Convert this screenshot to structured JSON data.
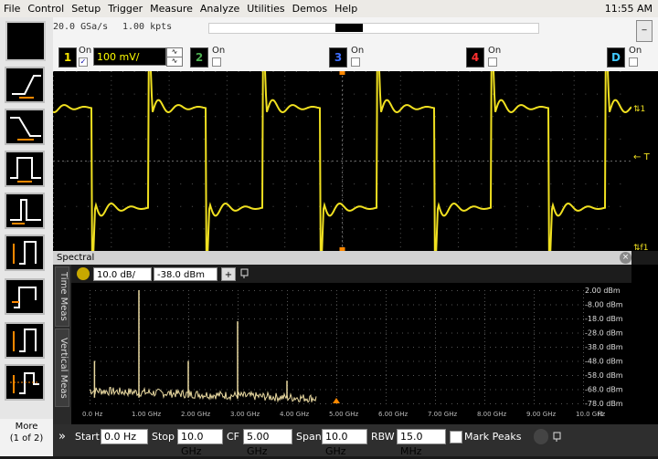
{
  "menu": {
    "items": [
      "File",
      "Control",
      "Setup",
      "Trigger",
      "Measure",
      "Analyze",
      "Utilities",
      "Demos",
      "Help"
    ],
    "clock": "11:55 AM"
  },
  "acquisition": {
    "sample_rate": "20.0 GSa/s",
    "points": "1.00 kpts",
    "minimize_label": "_"
  },
  "channels": [
    {
      "number": "1",
      "on_label": "On",
      "checked": true,
      "color": "#f5e400",
      "scale": "100 mV/"
    },
    {
      "number": "2",
      "on_label": "On",
      "checked": false,
      "color": "#4caf50"
    },
    {
      "number": "3",
      "on_label": "On",
      "checked": false,
      "color": "#3f6fff"
    },
    {
      "number": "4",
      "on_label": "On",
      "checked": false,
      "color": "#ff3030"
    },
    {
      "number": "D",
      "on_label": "On",
      "checked": false,
      "color": "#40c8ff"
    }
  ],
  "scope": {
    "trace_color": "#f0e020",
    "trigger_marker": "T"
  },
  "left_toolbar": {
    "more_label": "More",
    "more_sub": "(1 of 2)"
  },
  "spectral": {
    "title": "Spectral",
    "close_label": "×",
    "tab_time": "Time Meas",
    "tab_vertical": "Vertical Meas",
    "scale": "10.0 dB/",
    "offset": "-38.0 dBm",
    "plus_label": "+",
    "trace_color": "#e8d8a0",
    "y_labels": [
      "2.00 dBm",
      "-8.00 dBm",
      "-18.0 dBm",
      "-28.0 dBm",
      "-38.0 dBm",
      "-48.0 dBm",
      "-58.0 dBm",
      "-68.0 dBm",
      "-78.0 dBm"
    ],
    "x_labels": [
      "0.0 Hz",
      "1.00 GHz",
      "2.00 GHz",
      "3.00 GHz",
      "4.00 GHz",
      "5.00 GHz",
      "6.00 GHz",
      "7.00 GHz",
      "8.00 GHz",
      "9.00 GHz",
      "10.0 GHz"
    ],
    "x_suffix": "f1"
  },
  "bottom_controls": {
    "start_label": "Start",
    "start_value": "0.0 Hz",
    "stop_label": "Stop",
    "stop_value": "10.0 GHz",
    "cf_label": "CF",
    "cf_value": "5.00 GHz",
    "span_label": "Span",
    "span_value": "10.0 GHz",
    "rbw_label": "RBW",
    "rbw_value": "15.0 MHz",
    "mark_peaks_label": "Mark Peaks",
    "expand_label": "»"
  }
}
